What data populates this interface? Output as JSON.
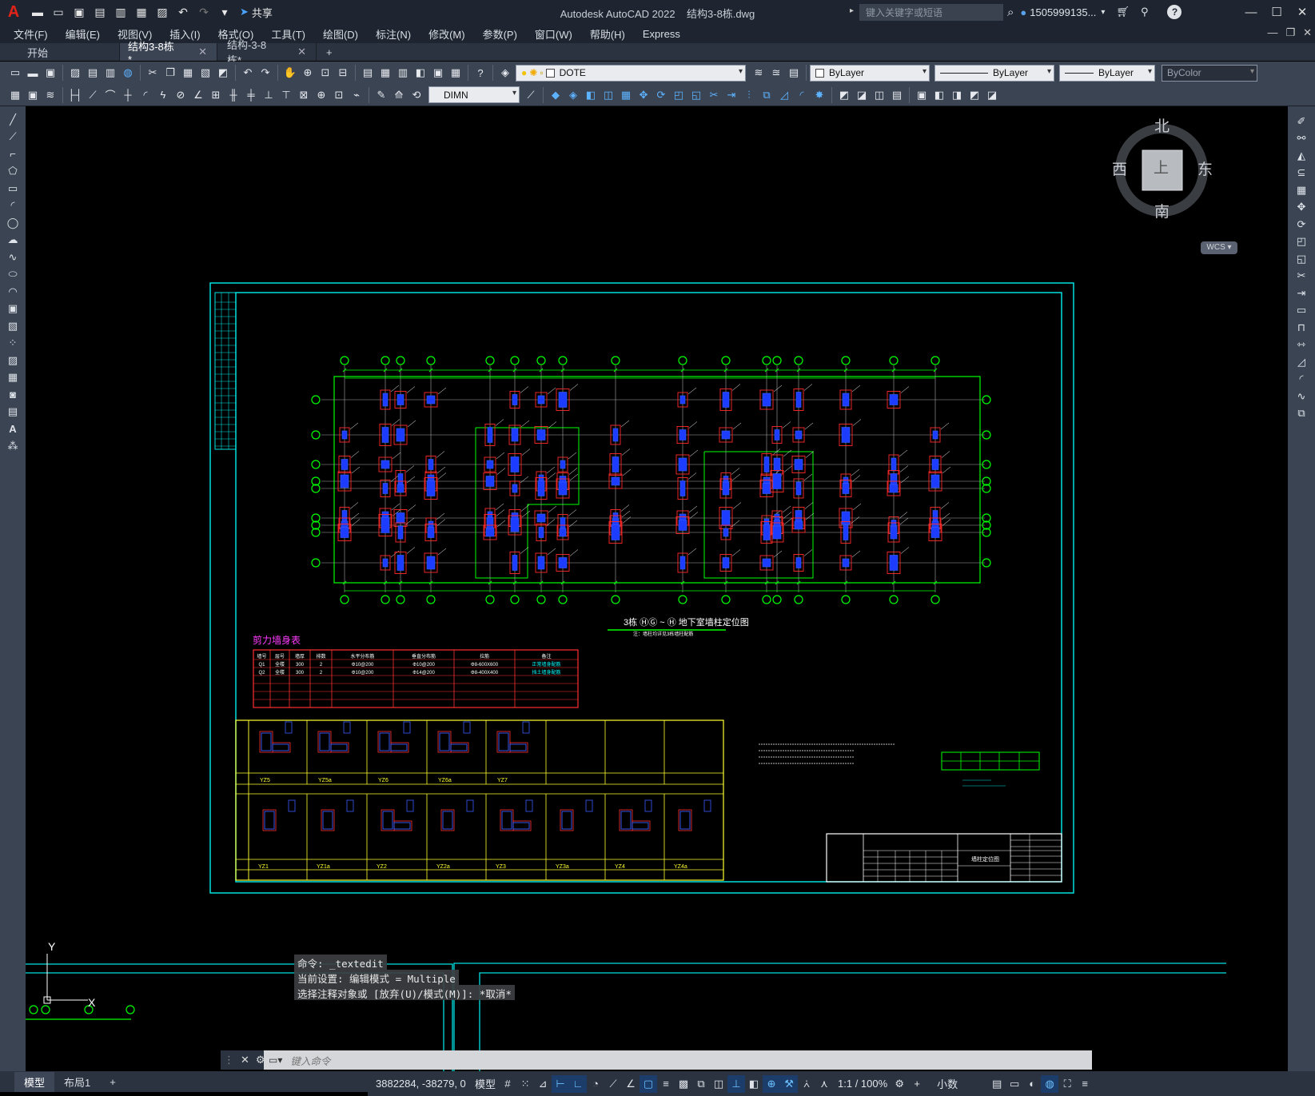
{
  "app": {
    "title": "Autodesk AutoCAD 2022",
    "drawing": "结构3-8栋.dwg",
    "share_label": "共享",
    "search_placeholder": "键入关键字或短语",
    "user": "1505999135...",
    "help": "?"
  },
  "menu": [
    "文件(F)",
    "编辑(E)",
    "视图(V)",
    "插入(I)",
    "格式(O)",
    "工具(T)",
    "绘图(D)",
    "标注(N)",
    "修改(M)",
    "参数(P)",
    "窗口(W)",
    "帮助(H)",
    "Express"
  ],
  "file_tabs": [
    {
      "label": "开始",
      "active": false
    },
    {
      "label": "结构3-8栋*",
      "active": true
    },
    {
      "label": "结构-3-8栋*",
      "active": false
    }
  ],
  "toolbar": {
    "layer": "DOTE",
    "color": "ByLayer",
    "linetype": "ByLayer",
    "lineweight": "ByLayer",
    "plotstyle": "ByColor",
    "dimstyle": "DIMN"
  },
  "viewcube": {
    "north": "北",
    "south": "南",
    "west": "西",
    "east": "东",
    "top": "上",
    "wcs": "WCS"
  },
  "drawing": {
    "plan_title": "3栋 ⒽⒼ ~ Ⓗ 地下室墙柱定位图",
    "plan_subtitle": "注：墙柱均详见3栋墙柱配筋",
    "wall_table_title": "剪力墙身表",
    "wall_table": {
      "headers": [
        "墙号",
        "层号",
        "墙厚",
        "排数",
        "水平分布筋",
        "垂直分布筋",
        "拉筋",
        "备注"
      ],
      "rows": [
        [
          "Q1",
          "全楼",
          "300",
          "2",
          "Φ10@200",
          "Φ10@200",
          "Φ8-600X600",
          "正常墙身配筋"
        ],
        [
          "Q2",
          "全楼",
          "300",
          "2",
          "Φ10@200",
          "Φ14@200",
          "Φ8-400X400",
          "挡土墙身配筋"
        ]
      ]
    },
    "detail_row1": [
      "YZ5",
      "YZ5a",
      "YZ6",
      "YZ6a",
      "YZ7"
    ],
    "detail_row2": [
      "YZ1",
      "YZ1a",
      "YZ2",
      "YZ2a",
      "YZ3",
      "YZ3a",
      "YZ4",
      "YZ4a"
    ],
    "titleblock_name": "墙柱定位图"
  },
  "command": {
    "history": [
      "命令: _textedit",
      "当前设置: 编辑模式 = Multiple",
      "选择注释对象或 [放弃(U)/模式(M)]: *取消*"
    ],
    "placeholder": "键入命令"
  },
  "ucs": {
    "x": "X",
    "y": "Y"
  },
  "layout_tabs": [
    {
      "label": "模型",
      "active": true
    },
    {
      "label": "布局1",
      "active": false
    }
  ],
  "status": {
    "coords": "3882284, -38279, 0",
    "space": "模型",
    "scale": "1:1 / 100%",
    "units": "小数"
  }
}
